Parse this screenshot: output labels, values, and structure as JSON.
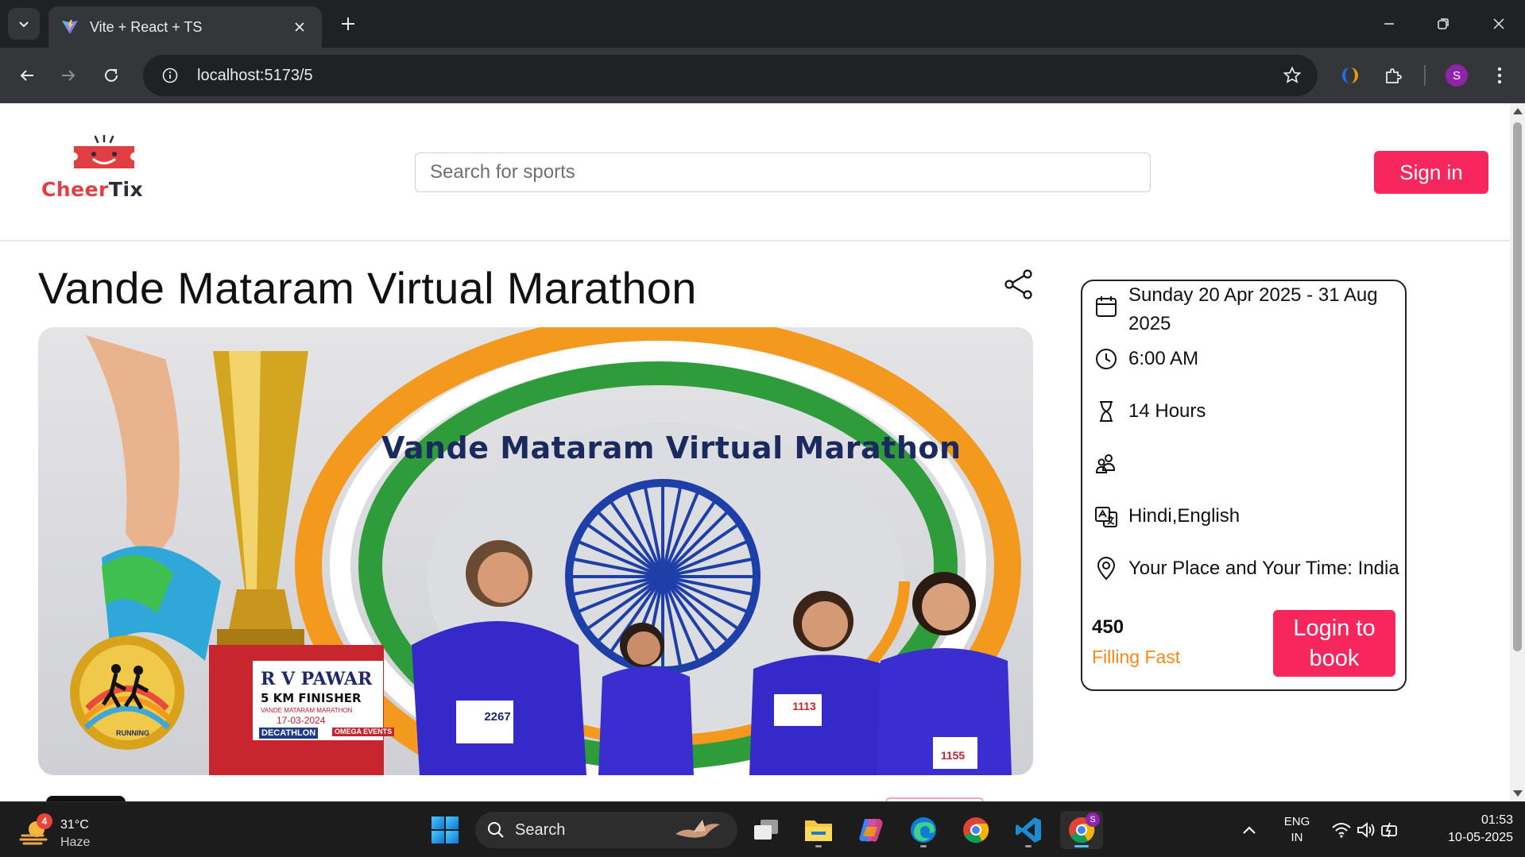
{
  "browser": {
    "tab_title": "Vite + React + TS",
    "url": "localhost:5173/5"
  },
  "header": {
    "logo_brand_first": "Cheer",
    "logo_brand_second": "Tix",
    "search_placeholder": "Search for sports",
    "signin_label": "Sign in"
  },
  "event": {
    "title": "Vande Mataram Virtual Marathon",
    "banner": {
      "heading": "Vande Mataram Virtual Marathon",
      "plaque_name": "R V PAWAR",
      "plaque_sub": "5 KM FINISHER",
      "plaque_event": "VANDE MATARAM MARATHON",
      "plaque_date": "17-03-2024",
      "plaque_sponsor1": "DECATHLON",
      "plaque_sponsor2": "OMEGA EVENTS",
      "medal_text": "RUNNING",
      "bibs": [
        "2267",
        "1113",
        "1155"
      ]
    }
  },
  "details": {
    "date": "Sunday 20 Apr 2025 - 31 Aug 2025",
    "time": "6:00 AM",
    "duration": "14 Hours",
    "age": "",
    "language": "Hindi,English",
    "venue": "Your Place and Your Time: India",
    "seats": "450",
    "status": "Filling Fast",
    "login_label": "Login to book"
  },
  "taskbar": {
    "weather_badge": "4",
    "weather_temp": "31°C",
    "weather_condition": "Haze",
    "search_label": "Search",
    "chrome_profile_badge": "S",
    "lang_line1": "ENG",
    "lang_line2": "IN",
    "time": "01:53",
    "date": "10-05-2025"
  },
  "colors": {
    "brand_pink": "#f7275d",
    "logo_red": "#e04043",
    "filling_orange": "#f08a1a"
  }
}
